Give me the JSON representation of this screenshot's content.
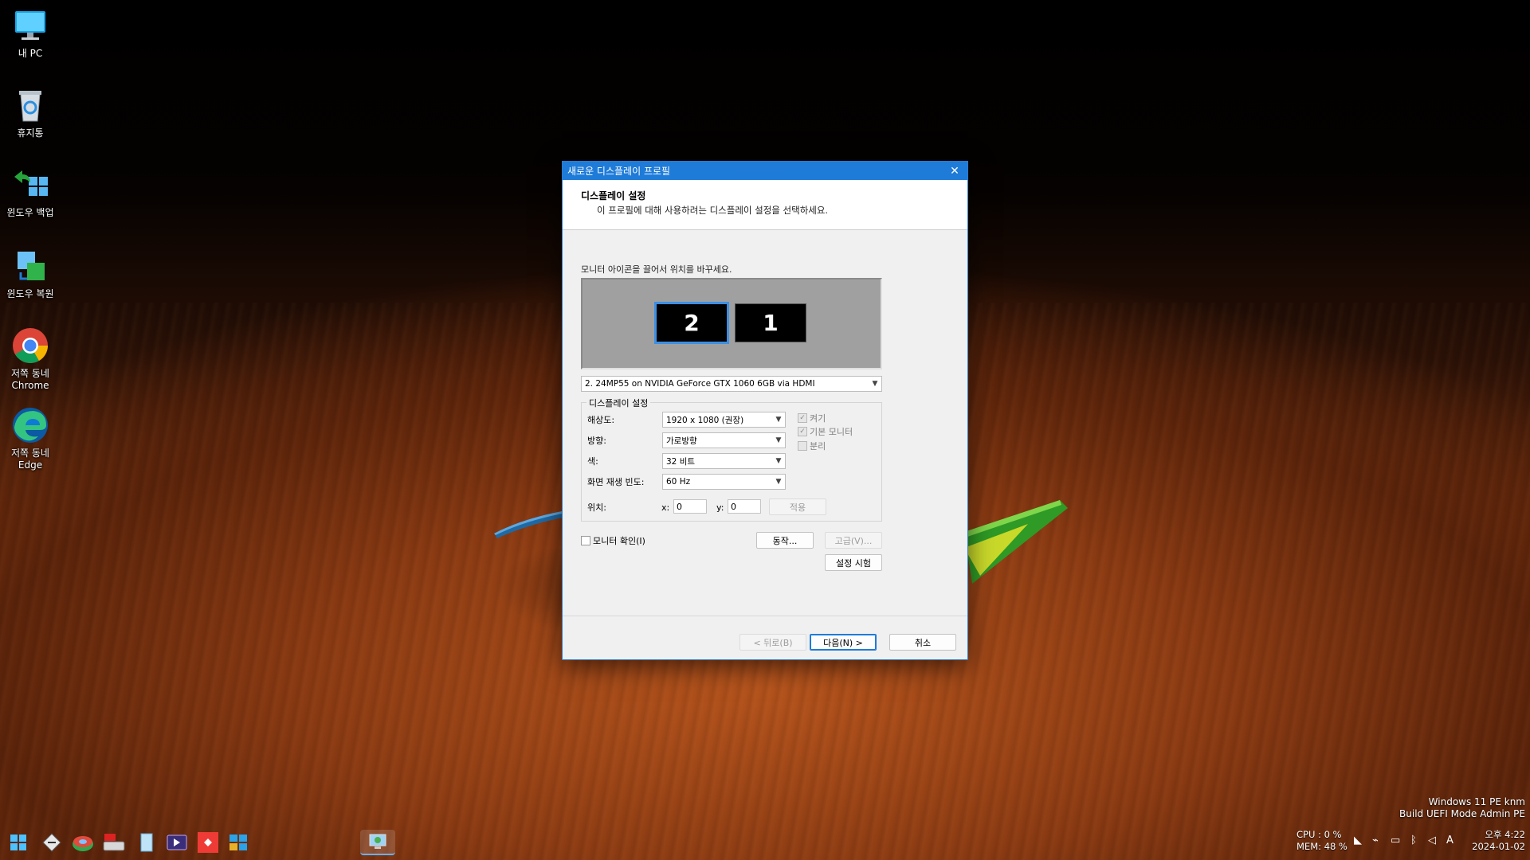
{
  "desktop": {
    "icons": [
      {
        "label": "내 PC",
        "icon": "monitor-pc-icon"
      },
      {
        "label": "휴지통",
        "icon": "recycle-bin-icon"
      },
      {
        "label": "윈도우 백업",
        "icon": "windows-backup-icon"
      },
      {
        "label": "윈도우 복원",
        "icon": "windows-restore-icon"
      },
      {
        "label": "저쪽 동네\nChrome",
        "icon": "chrome-icon"
      },
      {
        "label": "저쪽 동네\nEdge",
        "icon": "edge-icon"
      }
    ]
  },
  "dialog": {
    "title": "새로운 디스플레이 프로필",
    "close_glyph": "✕",
    "header_title": "디스플레이 설정",
    "header_subtitle": "이 프로필에 대해 사용하려는 디스플레이 설정을 선택하세요.",
    "drag_hint": "모니터 아이콘을 끌어서 위치를 바꾸세요.",
    "monitors": [
      {
        "number": "2",
        "selected": true
      },
      {
        "number": "1",
        "selected": false
      }
    ],
    "monitor_select": "2. 24MP55 on NVIDIA GeForce GTX 1060 6GB via HDMI",
    "settings_group": {
      "legend": "디스플레이 설정",
      "resolution_label": "해상도:",
      "resolution_value": "1920 x 1080  (권장)",
      "orientation_label": "방향:",
      "orientation_value": "가로방향",
      "color_label": "색:",
      "color_value": "32 비트",
      "refresh_label": "화면 재생 빈도:",
      "refresh_value": "60 Hz",
      "position_label": "위치:",
      "x_label": "x:",
      "x_value": "0",
      "y_label": "y:",
      "y_value": "0",
      "apply_label": "적용",
      "on_label": "켜기",
      "on_checked": true,
      "primary_label": "기본 모니터",
      "primary_checked": true,
      "detach_label": "분리",
      "detach_checked": false
    },
    "identify_label": "모니터 확인(I)",
    "behavior_button": "동작...",
    "advanced_button": "고급(V)...",
    "test_button": "설정 시험",
    "back_button": "< 뒤로(B)",
    "next_button": "다음(N) >",
    "cancel_button": "취소"
  },
  "watermark": {
    "line1": "Windows 11 PE knm",
    "line2": "Build UEFI Mode Admin PE"
  },
  "system": {
    "cpu": "CPU :    0 %",
    "mem": "MEM: 48 %",
    "time": "오후 4:22",
    "date": "2024-01-02",
    "ime": "A"
  },
  "taskbar": {
    "icons": [
      "windows-start-icon",
      "tools-icon",
      "disk-utility-icon",
      "drive-icon",
      "document-icon",
      "media-icon",
      "anydesk-icon",
      "window-tiles-icon",
      "display-profile-icon"
    ]
  }
}
